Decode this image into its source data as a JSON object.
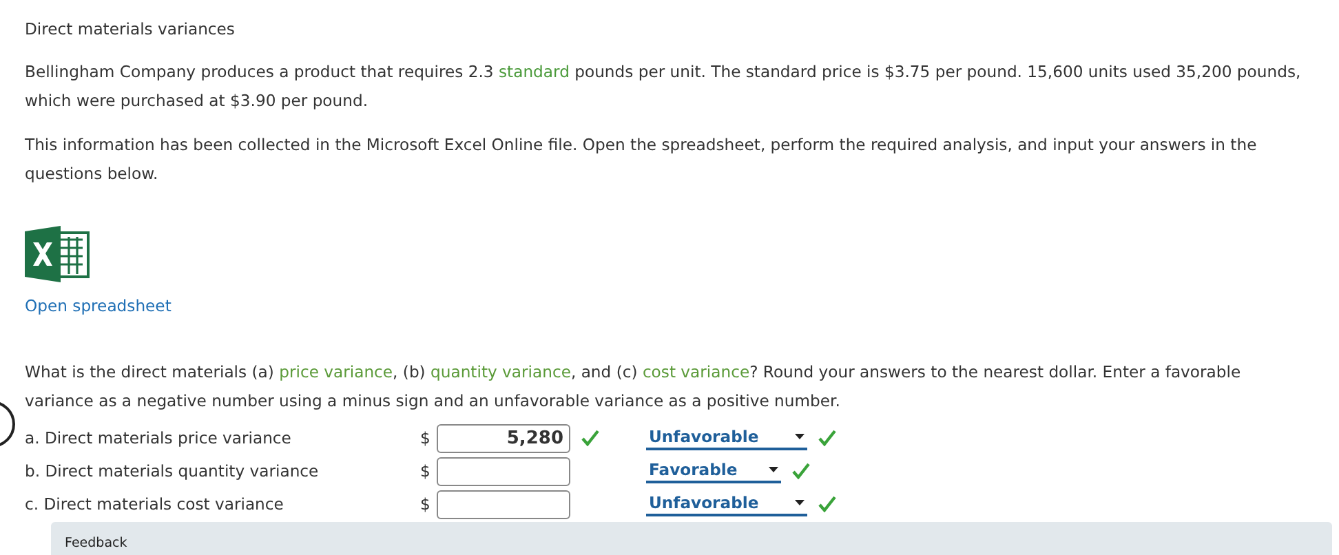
{
  "title": "Direct materials variances",
  "paragraphs": [
    [
      {
        "kind": "plain",
        "text": "Bellingham Company produces a product that requires 2.3 "
      },
      {
        "kind": "term",
        "text": "standard"
      },
      {
        "kind": "plain",
        "text": " pounds per unit. The standard price is $3.75 per pound. 15,600 units used 35,200 pounds, which were purchased at $3.90 per pound."
      }
    ],
    [
      {
        "kind": "plain",
        "text": "This information has been collected in the Microsoft Excel Online file. Open the spreadsheet, perform the required analysis, and input your answers in the questions below."
      }
    ]
  ],
  "spreadsheet_link": "Open spreadsheet",
  "question": [
    {
      "kind": "plain",
      "text": "What is the direct materials (a) "
    },
    {
      "kind": "link",
      "text": "price variance"
    },
    {
      "kind": "plain",
      "text": ", (b) "
    },
    {
      "kind": "link",
      "text": "quantity variance"
    },
    {
      "kind": "plain",
      "text": ", and (c) "
    },
    {
      "kind": "link",
      "text": "cost variance"
    },
    {
      "kind": "plain",
      "text": "? Round your answers to the nearest dollar. Enter a favorable variance as a negative number using a minus sign and an unfavorable variance as a positive number."
    }
  ],
  "answers": [
    {
      "label": "a. Direct materials price variance",
      "currency": "$",
      "value": "5,280",
      "value_correct": true,
      "choice": "Unfavorable",
      "choice_correct": true
    },
    {
      "label": "b. Direct materials quantity variance",
      "currency": "$",
      "value_correct": false,
      "choice": "Favorable",
      "choice_correct": true
    },
    {
      "label": "c. Direct materials cost variance",
      "currency": "$",
      "value_correct": false,
      "choice": "Unfavorable",
      "choice_correct": true
    }
  ],
  "feedback": {
    "title": "Feedback"
  }
}
